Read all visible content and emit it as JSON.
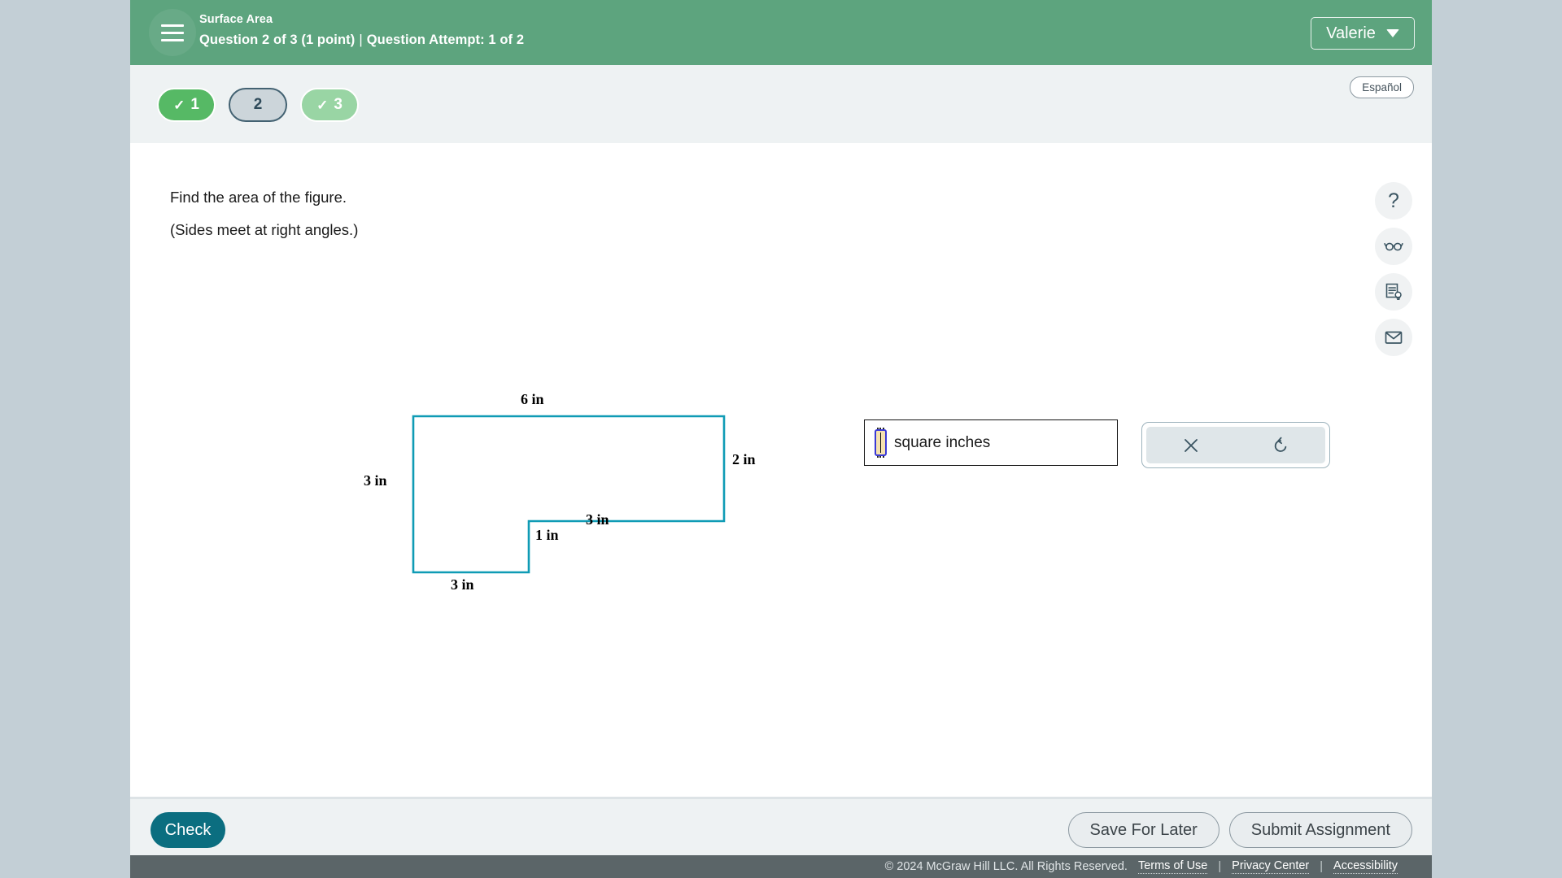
{
  "topbar": {
    "assignment_title": "Surface Area",
    "question_progress": "Question 2 of 3 (1 point)",
    "separator": "|",
    "attempt": "Question Attempt: 1 of 2",
    "user_name": "Valerie",
    "menu_icon": "hamburger-icon",
    "caret_icon": "chevron-down-icon"
  },
  "nav": {
    "pills": [
      {
        "label": "1",
        "check": "✓",
        "state": "completed"
      },
      {
        "label": "2",
        "check": "",
        "state": "current"
      },
      {
        "label": "3",
        "check": "✓",
        "state": "completed-soft"
      }
    ],
    "language_toggle": "Español"
  },
  "question": {
    "line1": "Find the area of the figure.",
    "line2": "(Sides meet at right angles.)"
  },
  "figure": {
    "shape": "L-shaped polygon",
    "stroke_color": "#0f9bb5",
    "labels": [
      {
        "text": "6 in",
        "side": "top"
      },
      {
        "text": "2 in",
        "side": "right-upper"
      },
      {
        "text": "3 in",
        "side": "middle-horizontal"
      },
      {
        "text": "1 in",
        "side": "inner-vertical"
      },
      {
        "text": "3 in",
        "side": "bottom"
      },
      {
        "text": "3 in",
        "side": "left"
      }
    ]
  },
  "answer": {
    "value": "",
    "placeholder": "",
    "unit_label": "square inches"
  },
  "tools": {
    "clear_label": "✕",
    "undo_label": "↺",
    "clear_name": "clear-answer",
    "undo_name": "undo"
  },
  "rail": [
    {
      "icon": "help-question-icon",
      "glyph": "?"
    },
    {
      "icon": "glasses-reading-icon",
      "glyph": ""
    },
    {
      "icon": "explain-document-icon",
      "glyph": ""
    },
    {
      "icon": "envelope-message-icon",
      "glyph": ""
    }
  ],
  "actions": {
    "check": "Check",
    "save_for_later": "Save For Later",
    "submit_assignment": "Submit Assignment"
  },
  "footer": {
    "copyright": "© 2024 McGraw Hill LLC. All Rights Reserved.",
    "terms": "Terms of Use",
    "privacy": "Privacy Center",
    "accessibility": "Accessibility",
    "separator": "|"
  },
  "colors": {
    "header_green": "#5da47e",
    "accent_teal": "#0b6e80",
    "figure_stroke": "#0f9bb5",
    "page_bg": "#c3cfd6"
  }
}
